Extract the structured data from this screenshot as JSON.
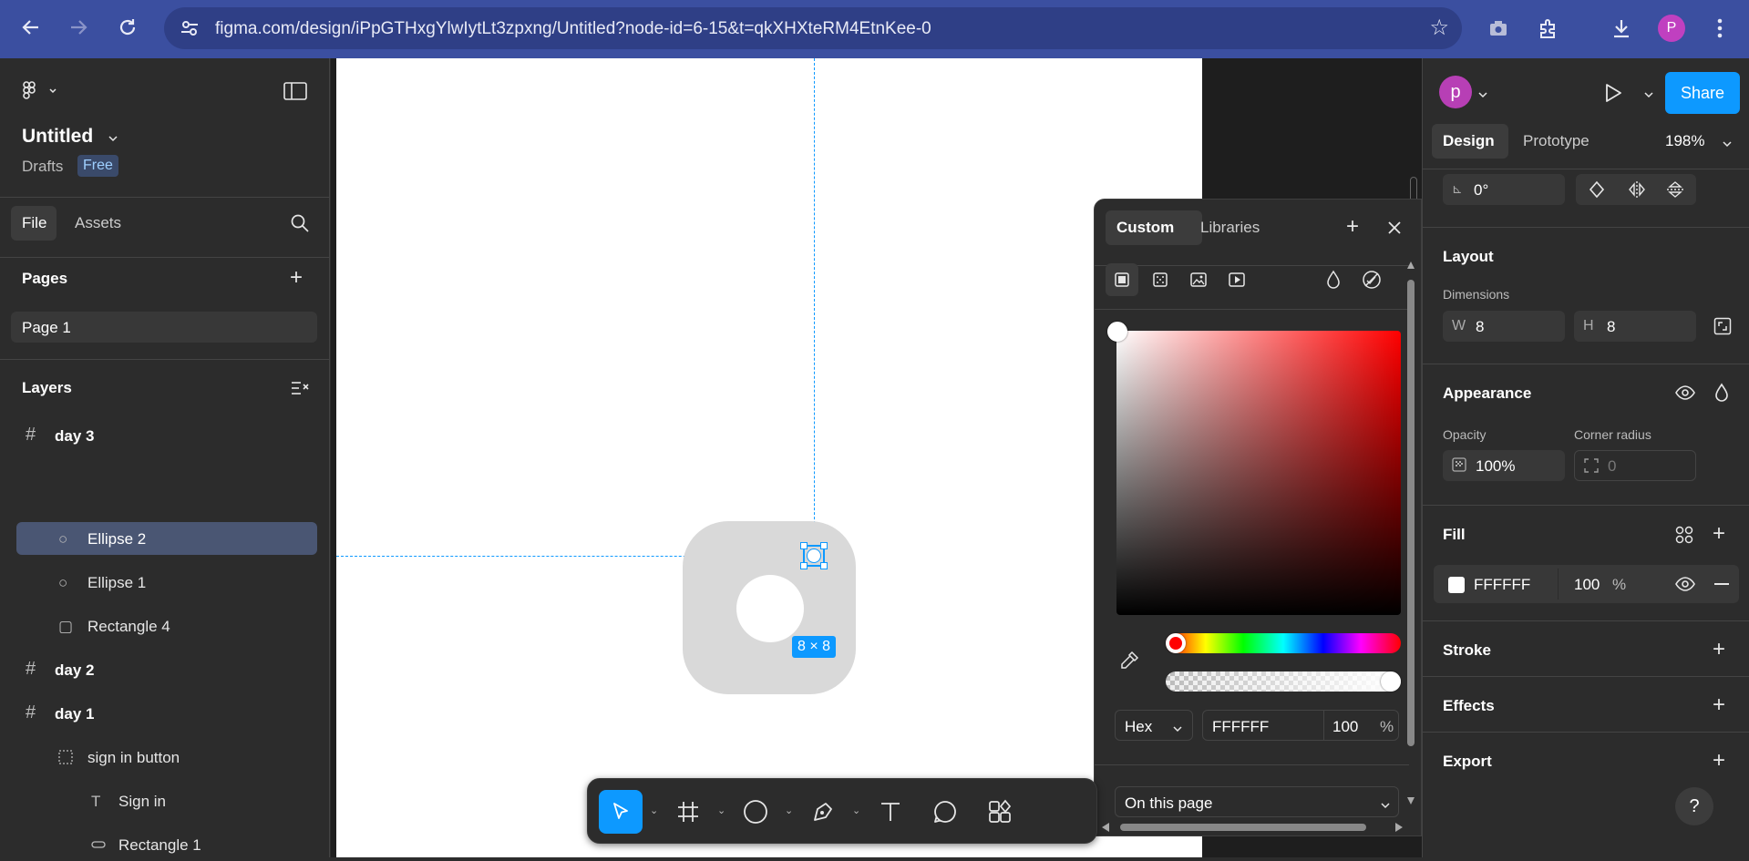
{
  "browser": {
    "url": "figma.com/design/iPpGTHxgYlwIytLt3zpxng/Untitled?node-id=6-15&t=qkXHXteRM4EtnKee-0",
    "profile_initial": "P"
  },
  "left_panel": {
    "file_name": "Untitled",
    "drafts_label": "Drafts",
    "plan_badge": "Free",
    "tabs": [
      "File",
      "Assets"
    ],
    "pages_title": "Pages",
    "page_item": "Page 1",
    "layers_title": "Layers",
    "layers": [
      {
        "name": "day 3",
        "type": "frame"
      },
      {
        "name": "Ellipse 2",
        "type": "ellipse",
        "selected": true
      },
      {
        "name": "Ellipse 1",
        "type": "ellipse"
      },
      {
        "name": "Rectangle 4",
        "type": "rectangle"
      },
      {
        "name": "day 2",
        "type": "frame"
      },
      {
        "name": "day 1",
        "type": "frame"
      },
      {
        "name": "sign in button",
        "type": "group"
      },
      {
        "name": "Sign in",
        "type": "text"
      },
      {
        "name": "Rectangle 1",
        "type": "rectangle"
      }
    ]
  },
  "canvas": {
    "selection_size_label": "8 × 8",
    "icon_bg_color": "#d9d9d9",
    "guide_color": "#0d99ff"
  },
  "picker": {
    "tabs": [
      "Custom",
      "Libraries"
    ],
    "format_label": "Hex",
    "hex_value": "FFFFFF",
    "opacity_value": "100",
    "percent": "%",
    "scope_label": "On this page"
  },
  "right_panel": {
    "user_initial": "p",
    "share_label": "Share",
    "tabs": [
      "Design",
      "Prototype"
    ],
    "zoom": "198%",
    "rotation": "0°",
    "layout_title": "Layout",
    "dimensions_label": "Dimensions",
    "w_label": "W",
    "w_value": "8",
    "h_label": "H",
    "h_value": "8",
    "appearance_title": "Appearance",
    "opacity_label": "Opacity",
    "opacity_value": "100%",
    "corner_radius_label": "Corner radius",
    "corner_radius_value": "0",
    "fill_title": "Fill",
    "fill_hex": "FFFFFF",
    "fill_opacity": "100",
    "fill_percent": "%",
    "stroke_title": "Stroke",
    "effects_title": "Effects",
    "export_title": "Export",
    "help": "?",
    "accent_color": "#0d99ff"
  }
}
